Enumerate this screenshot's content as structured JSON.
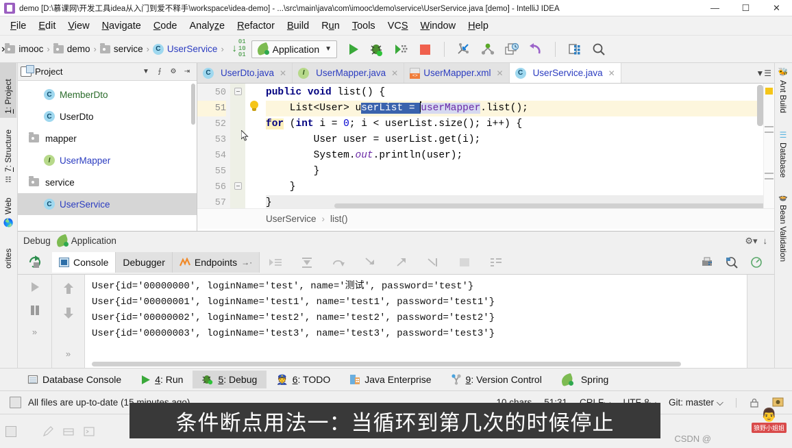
{
  "window": {
    "title": "demo [D:\\慕课网\\开发工具idea从入门到爱不释手\\workspace\\idea-demo] - ...\\src\\main\\java\\com\\imooc\\demo\\service\\UserService.java [demo] - IntelliJ IDEA",
    "minimize": "—",
    "maximize": "☐",
    "close": "✕"
  },
  "menubar": {
    "items": [
      {
        "pre": "",
        "mn": "F",
        "post": "ile"
      },
      {
        "pre": "",
        "mn": "E",
        "post": "dit"
      },
      {
        "pre": "",
        "mn": "V",
        "post": "iew"
      },
      {
        "pre": "",
        "mn": "N",
        "post": "avigate"
      },
      {
        "pre": "",
        "mn": "C",
        "post": "ode"
      },
      {
        "pre": "Analy",
        "mn": "z",
        "post": "e"
      },
      {
        "pre": "",
        "mn": "R",
        "post": "efactor"
      },
      {
        "pre": "",
        "mn": "B",
        "post": "uild"
      },
      {
        "pre": "R",
        "mn": "u",
        "post": "n"
      },
      {
        "pre": "",
        "mn": "T",
        "post": "ools"
      },
      {
        "pre": "VC",
        "mn": "S",
        "post": ""
      },
      {
        "pre": "",
        "mn": "W",
        "post": "indow"
      },
      {
        "pre": "",
        "mn": "H",
        "post": "elp"
      }
    ]
  },
  "navbar": {
    "crumbs": [
      {
        "label": "imooc",
        "icon": "folder-icon",
        "color": "dark"
      },
      {
        "label": "demo",
        "icon": "folder-icon",
        "color": "dark"
      },
      {
        "label": "service",
        "icon": "folder-icon",
        "color": "dark"
      },
      {
        "label": "UserService",
        "icon": "class-icon",
        "color": "blue"
      }
    ],
    "run_config": {
      "label": "Application",
      "chevron": "⌵"
    },
    "binary_icon_digits": [
      "01",
      "10",
      "01"
    ],
    "tools": [
      {
        "name": "run-button",
        "glyph": "▶"
      },
      {
        "name": "debug-button",
        "glyph": "bug"
      },
      {
        "name": "run-coverage-button",
        "glyph": "coverage"
      },
      {
        "name": "stop-button",
        "glyph": "stop"
      },
      {
        "name": "attach-debugger-button",
        "glyph": "attach"
      },
      {
        "name": "profiler-button",
        "glyph": "profile"
      },
      {
        "name": "update-project-button",
        "glyph": "update"
      },
      {
        "name": "rollback-button",
        "glyph": "rollback"
      },
      {
        "name": "database-button",
        "glyph": "db"
      },
      {
        "name": "search-everywhere-button",
        "glyph": "search"
      }
    ]
  },
  "left_tool_tabs": [
    {
      "label": "1: Project",
      "mn": "1",
      "active": true
    },
    {
      "label": "7: Structure",
      "mn": "7",
      "active": false
    },
    {
      "label": "Web",
      "mn": "",
      "active": false
    },
    {
      "label": "orites",
      "mn": "",
      "active": false
    }
  ],
  "right_tool_tabs": [
    {
      "label": "Ant Build",
      "icon": "ant-icon"
    },
    {
      "label": "Database",
      "icon": "database-icon"
    },
    {
      "label": "Bean Validation",
      "icon": "bean-icon"
    }
  ],
  "project_panel": {
    "title": "Project",
    "dropdown": "▼",
    "collapse_all": "⨍",
    "settings": "⚙",
    "hide": "⇥",
    "tree": [
      {
        "label": "MemberDto",
        "icon": "class-icon",
        "indent": 2,
        "color": "green",
        "selected": false
      },
      {
        "label": "UserDto",
        "icon": "class-icon",
        "indent": 2,
        "color": "dark",
        "selected": false
      },
      {
        "label": "mapper",
        "icon": "folder-icon",
        "indent": 1,
        "color": "dark",
        "selected": false
      },
      {
        "label": "UserMapper",
        "icon": "interface-icon",
        "indent": 2,
        "color": "blue",
        "selected": false
      },
      {
        "label": "service",
        "icon": "folder-icon",
        "indent": 1,
        "color": "dark",
        "selected": false
      },
      {
        "label": "UserService",
        "icon": "class-icon",
        "indent": 2,
        "color": "selblue",
        "selected": true
      }
    ]
  },
  "editor": {
    "tabs": [
      {
        "label": "UserDto.java",
        "icon": "class-icon",
        "active": false,
        "close": "✕"
      },
      {
        "label": "UserMapper.java",
        "icon": "interface-icon",
        "active": false,
        "close": "✕"
      },
      {
        "label": "UserMapper.xml",
        "icon": "xml-icon",
        "active": false,
        "close": "✕"
      },
      {
        "label": "UserService.java",
        "icon": "class-icon",
        "active": true,
        "close": "✕"
      }
    ],
    "line_numbers": [
      "50",
      "51",
      "52",
      "53",
      "54",
      "55",
      "56",
      "57"
    ],
    "code": {
      "l50_kw1": "public",
      "l50_kw2": "void",
      "l50_rest": " list() {",
      "l51_pre": "    List<User> u",
      "l51_sel": "serList = ",
      "l51_var": "userMapper",
      "l51_post": ".list();",
      "l52_kw": "for",
      "l52_a": " (",
      "l52_int": "int",
      "l52_b": " i = ",
      "l52_zero": "0",
      "l52_c": "; i < userList.size(); i++) {",
      "l53": "        User user = userList.get(i);",
      "l54_a": "        System.",
      "l54_out": "out",
      "l54_b": ".println(user);",
      "l55": "        }",
      "l56": "    }",
      "l57": "}"
    },
    "breadcrumbs": {
      "class": "UserService",
      "sep": "›",
      "method": "list()"
    }
  },
  "debug_panel": {
    "header": {
      "title": "Debug",
      "config": "Application"
    },
    "tabs": [
      {
        "label": "Console",
        "icon": "console-icon",
        "active": true
      },
      {
        "label": "Debugger",
        "icon": "",
        "active": false
      },
      {
        "label": "Endpoints",
        "icon": "endpoints-icon",
        "active": false
      }
    ],
    "tabs_more": "→·",
    "console_lines": [
      "User{id='00000000', loginName='test', name='测试', password='test'}",
      "User{id='00000001', loginName='test1', name='test1', password='test1'}",
      "User{id='00000002', loginName='test2', name='test2', password='test2'}",
      "User{id='00000003', loginName='test3', name='test3', password='test3'}"
    ],
    "left_tools": [
      {
        "name": "rerun-button",
        "glyph": "⟳"
      },
      {
        "name": "resume-button",
        "glyph": "▶"
      },
      {
        "name": "pause-button",
        "glyph": "⏸"
      },
      {
        "name": "expand-button",
        "glyph": "»"
      }
    ],
    "scroll_tools": [
      {
        "name": "scroll-up-button",
        "glyph": "↑"
      },
      {
        "name": "scroll-down-button",
        "glyph": "↓"
      },
      {
        "name": "more-button",
        "glyph": "»"
      }
    ]
  },
  "bottom_bar": {
    "items": [
      {
        "label": "Database Console",
        "mn": "",
        "icon": "database-console-icon",
        "active": false
      },
      {
        "label": "4: Run",
        "mn": "4",
        "icon": "run-icon",
        "active": false
      },
      {
        "label": "5: Debug",
        "mn": "5",
        "icon": "debug-icon",
        "active": true
      },
      {
        "label": "6: TODO",
        "mn": "6",
        "icon": "todo-icon",
        "active": false
      },
      {
        "label": "Java Enterprise",
        "mn": "",
        "icon": "java-ee-icon",
        "active": false
      },
      {
        "label": "9: Version Control",
        "mn": "9",
        "icon": "vcs-icon",
        "active": false
      },
      {
        "label": "Spring",
        "mn": "",
        "icon": "spring-icon",
        "active": false
      }
    ]
  },
  "status_bar": {
    "message": "All files are up-to-date (15 minutes ago)",
    "chars": "10 chars",
    "caret": "51:31",
    "line_sep": "CRLF⌵",
    "encoding": "UTF-8⌵",
    "git": "Git: master ⌵"
  },
  "overlay": {
    "caption": "条件断点用法一：当循环到第几次的时候停止"
  },
  "watermark": {
    "csdn": "CSDN @",
    "brand": "狼野小姐姐"
  }
}
